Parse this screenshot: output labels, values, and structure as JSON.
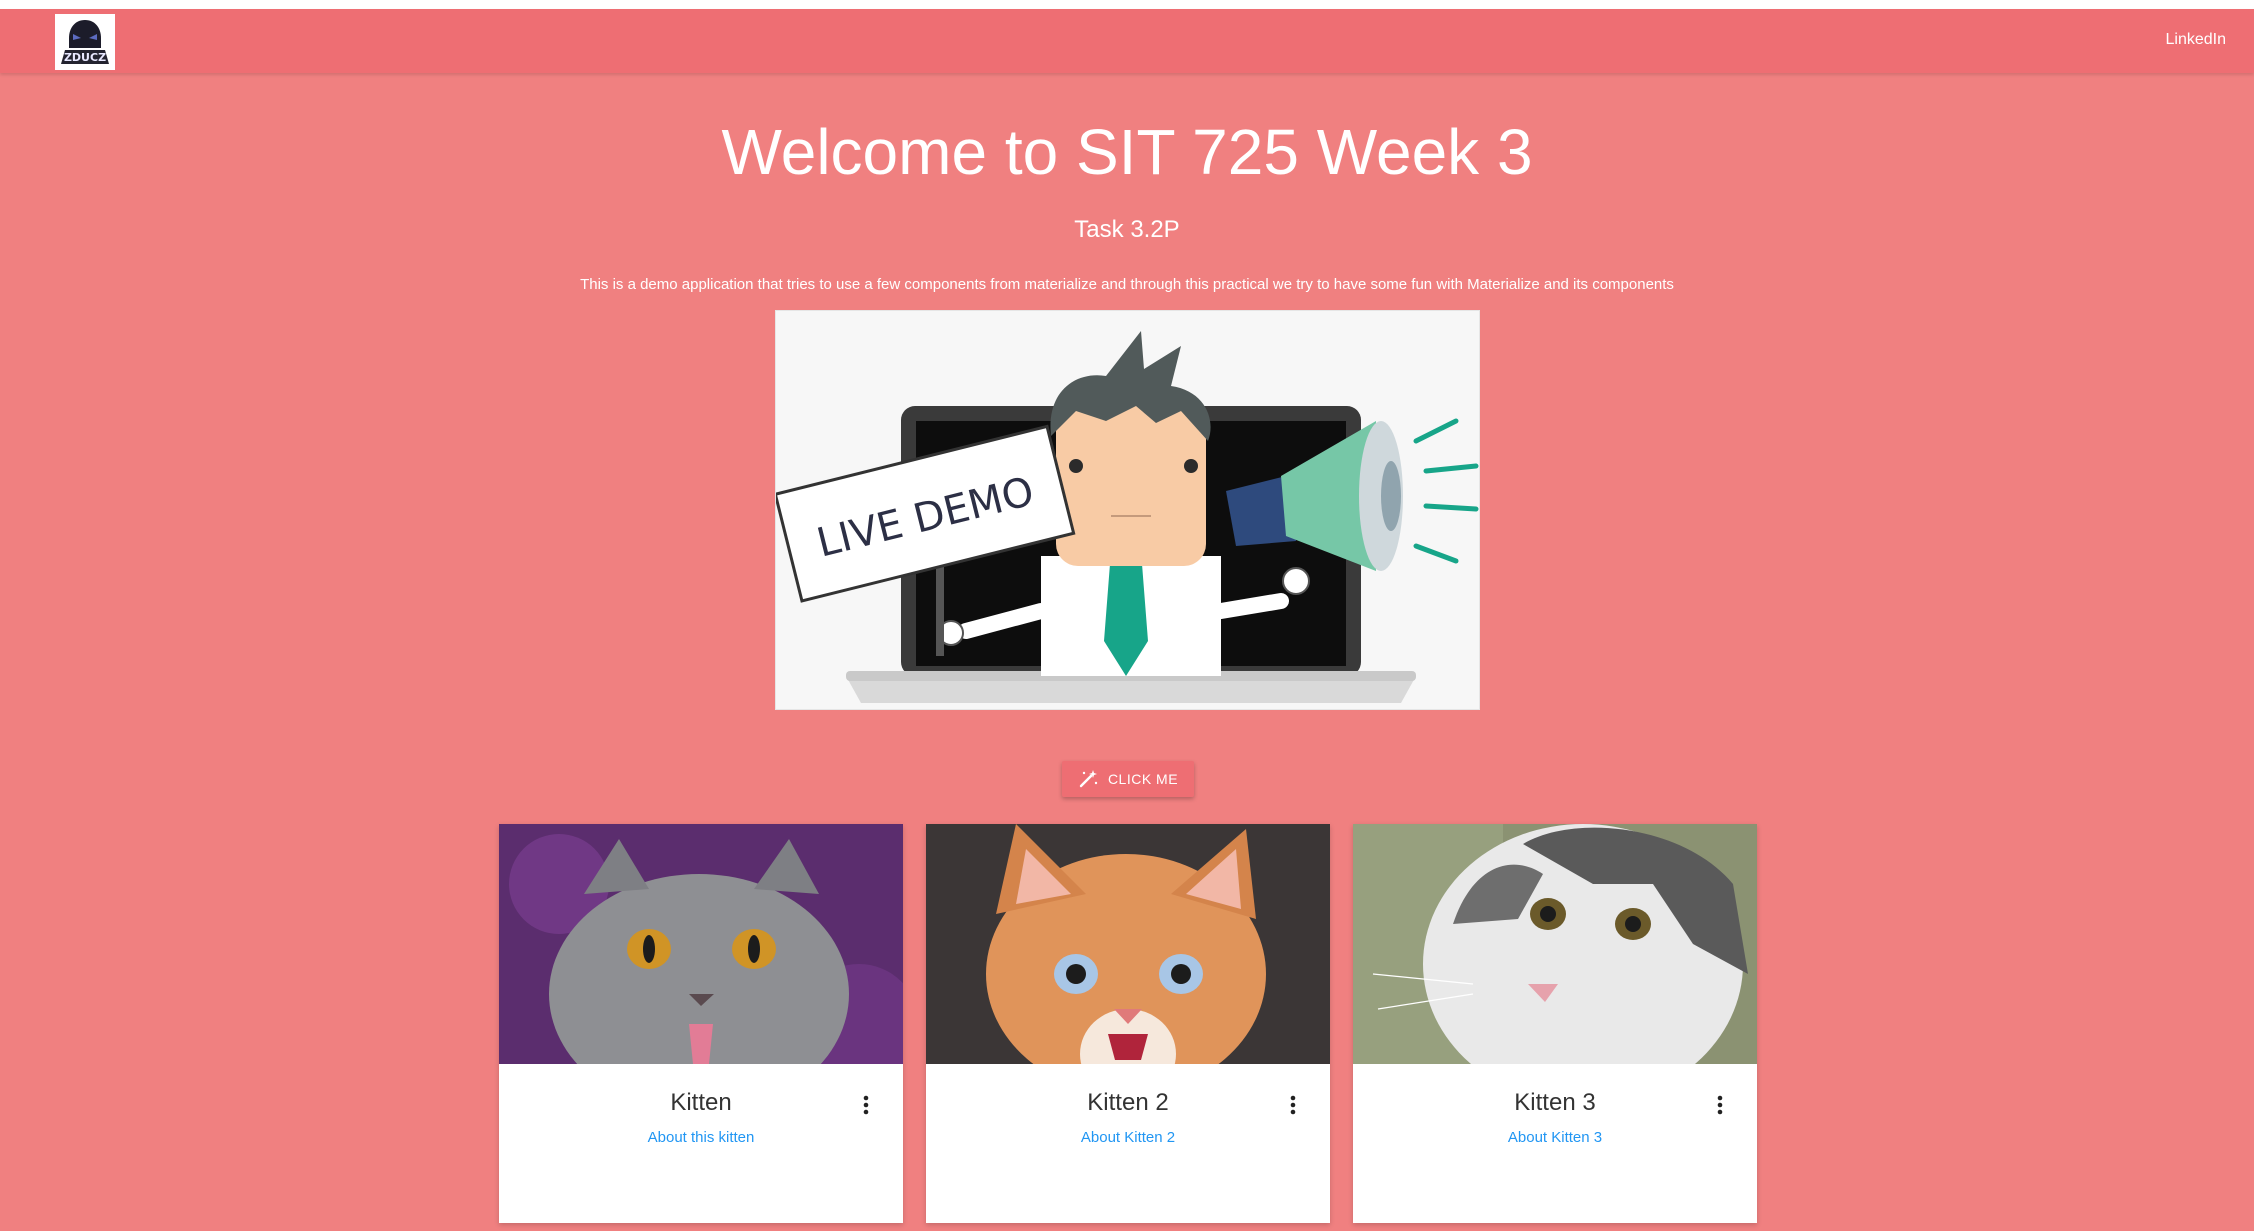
{
  "nav": {
    "logo_text": "ZDUCZ",
    "link": "LinkedIn"
  },
  "hero": {
    "title": "Welcome to SIT 725 Week 3",
    "subtitle": "Task 3.2P",
    "description": "This is a demo application that tries to use a few components from materialize and through this practical we try to have some fun with Materialize and its components",
    "image_sign_text": "LIVE DEMO"
  },
  "button": {
    "label": "CLICK ME",
    "icon": "magic-wand-icon"
  },
  "cards": [
    {
      "title": "Kitten",
      "link": "About this kitten"
    },
    {
      "title": "Kitten 2",
      "link": "About Kitten 2"
    },
    {
      "title": "Kitten 3",
      "link": "About Kitten 3"
    }
  ],
  "colors": {
    "background": "#f08080",
    "navbar": "#ee6e73",
    "link": "#2196f3"
  }
}
